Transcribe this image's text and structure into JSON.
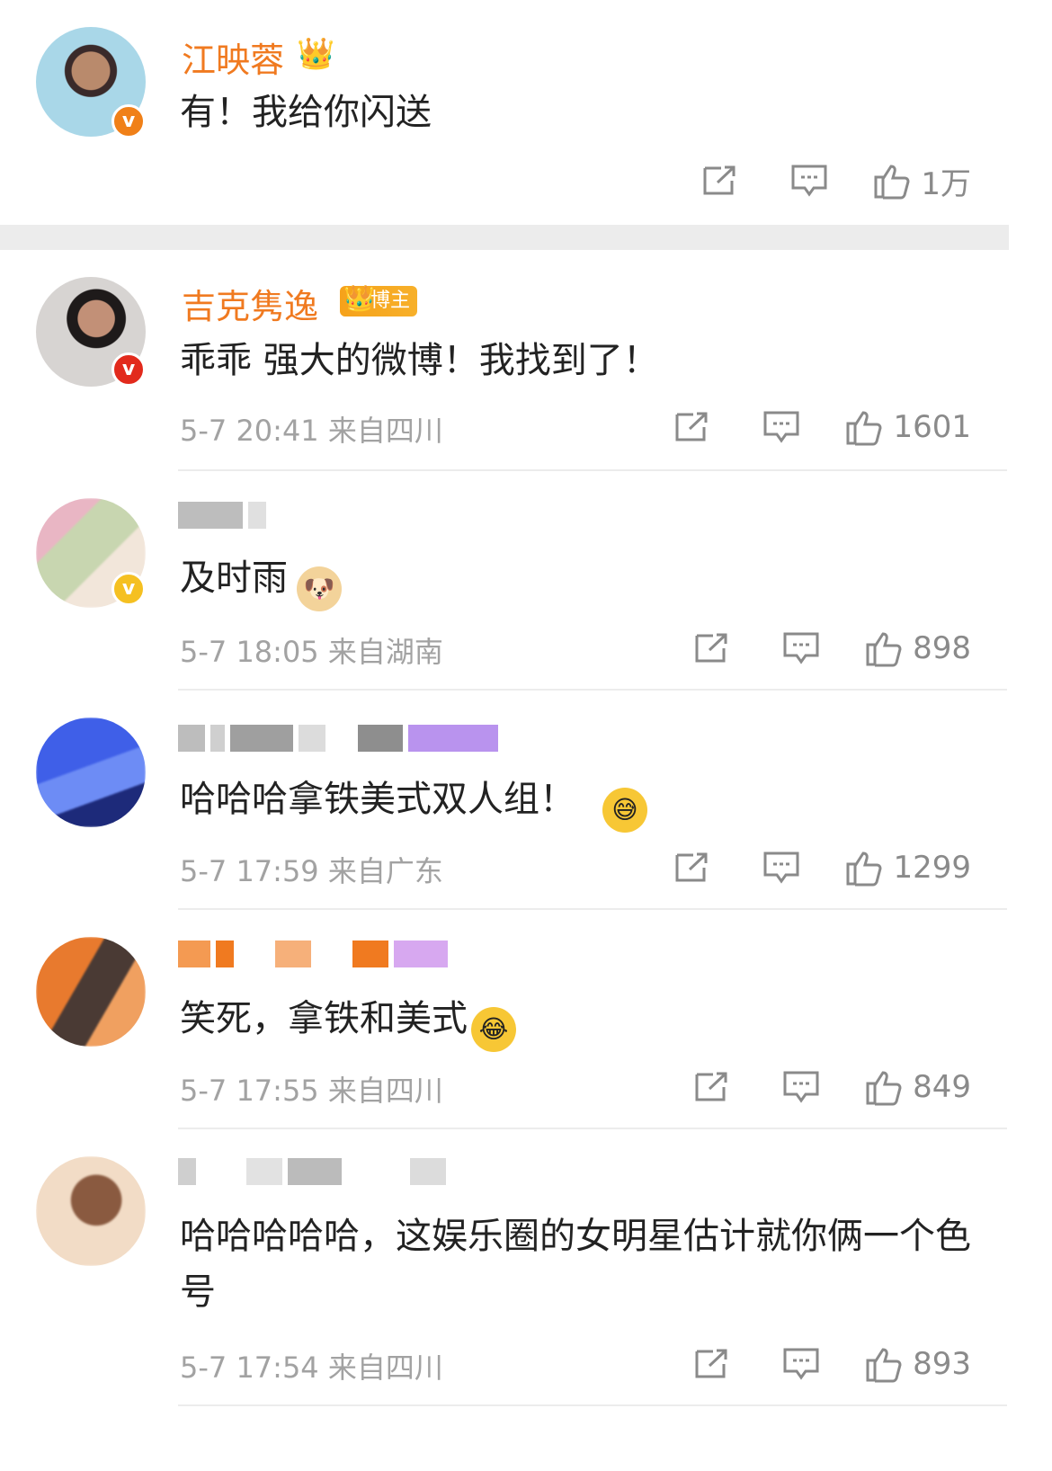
{
  "comments": [
    {
      "username": "江映蓉",
      "text": "有！我给你闪送",
      "meta": "",
      "likes": "1万",
      "badge_color": "#f08018",
      "icons": [
        "share-icon",
        "comment-icon",
        "like-icon"
      ]
    },
    {
      "username": "吉克隽逸",
      "tag": "博主",
      "text": "乖乖 强大的微博！我找到了！",
      "meta": "5-7 20:41  来自四川",
      "likes": "1601",
      "badge_color": "#e22a1c"
    },
    {
      "username": "",
      "text": "及时雨",
      "emoji": "doge-emoji",
      "meta": "5-7 18:05  来自湖南",
      "likes": "898",
      "badge_color": "#f5c021"
    },
    {
      "username": "",
      "text": "哈哈哈拿铁美式双人组！",
      "emoji": "sweat-laugh-emoji",
      "meta": "5-7 17:59  来自广东",
      "likes": "1299"
    },
    {
      "username": "",
      "text": "笑死，拿铁和美式",
      "emoji": "tears-of-joy-emoji",
      "meta": "5-7 17:55  来自四川",
      "likes": "849"
    },
    {
      "username": "",
      "text": "哈哈哈哈哈，这娱乐圈的女明星估计就你俩一个色号",
      "meta": "5-7 17:54  来自四川",
      "likes": "893"
    }
  ]
}
